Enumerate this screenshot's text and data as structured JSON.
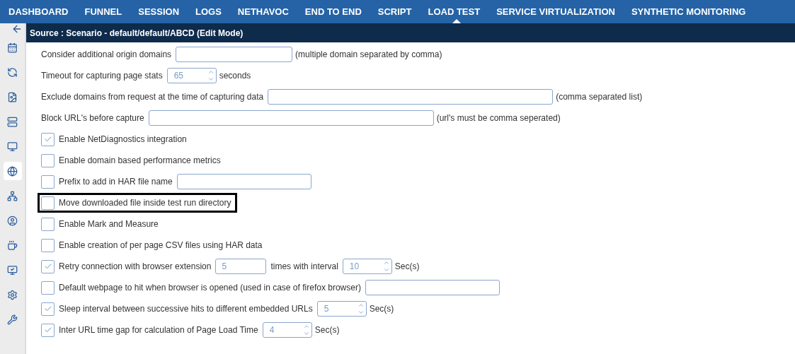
{
  "nav": {
    "tabs": [
      {
        "label": "DASHBOARD",
        "selected": false
      },
      {
        "label": "FUNNEL",
        "selected": false
      },
      {
        "label": "SESSION",
        "selected": false
      },
      {
        "label": "LOGS",
        "selected": false
      },
      {
        "label": "NETHAVOC",
        "selected": false
      },
      {
        "label": "END TO END",
        "selected": false
      },
      {
        "label": "SCRIPT",
        "selected": false
      },
      {
        "label": "LOAD TEST",
        "selected": true
      },
      {
        "label": "SERVICE VIRTUALIZATION",
        "selected": false
      },
      {
        "label": "SYNTHETIC MONITORING",
        "selected": false
      }
    ]
  },
  "sidebar": {
    "items": [
      {
        "selected": false
      },
      {
        "selected": false
      },
      {
        "selected": false
      },
      {
        "selected": false
      },
      {
        "selected": false
      },
      {
        "selected": true
      },
      {
        "selected": false
      },
      {
        "selected": false
      },
      {
        "selected": false
      },
      {
        "selected": false
      },
      {
        "selected": false
      },
      {
        "selected": false
      }
    ]
  },
  "header": {
    "title": "Source : Scenario - default/default/ABCD (Edit Mode)"
  },
  "rows": [
    {
      "highlighted": false,
      "parts": [
        {
          "kind": "label",
          "text": "Consider additional origin domains"
        },
        {
          "kind": "input"
        },
        {
          "kind": "note",
          "text": "(multiple domain separated by comma)"
        }
      ]
    },
    {
      "highlighted": false,
      "parts": [
        {
          "kind": "label",
          "text": "Timeout for capturing page stats"
        },
        {
          "kind": "spinner",
          "value": "65"
        },
        {
          "kind": "note",
          "text": "seconds"
        }
      ]
    },
    {
      "highlighted": false,
      "parts": [
        {
          "kind": "label",
          "text": "Exclude domains from request at the time of capturing data"
        },
        {
          "kind": "wide-input"
        },
        {
          "kind": "note",
          "text": "(comma separated list)"
        }
      ]
    },
    {
      "highlighted": false,
      "parts": [
        {
          "kind": "label",
          "text": "Block URL's before capture"
        },
        {
          "kind": "wide-input"
        },
        {
          "kind": "note",
          "text": "(url's must be comma seperated)"
        }
      ]
    },
    {
      "highlighted": false,
      "checked": true,
      "parts": [
        {
          "kind": "label",
          "text": "Enable NetDiagnostics integration"
        }
      ]
    },
    {
      "highlighted": false,
      "checked": false,
      "parts": [
        {
          "kind": "label",
          "text": "Enable domain based performance metrics"
        }
      ]
    },
    {
      "highlighted": false,
      "checked": false,
      "parts": [
        {
          "kind": "label",
          "text": "Prefix to add in HAR file name"
        },
        {
          "kind": "long-input"
        }
      ]
    },
    {
      "highlighted": true,
      "checked": false,
      "parts": [
        {
          "kind": "label",
          "text": "Move downloaded file inside test run directory"
        }
      ]
    },
    {
      "highlighted": false,
      "checked": false,
      "parts": [
        {
          "kind": "label",
          "text": "Enable Mark and Measure"
        }
      ]
    },
    {
      "highlighted": false,
      "checked": false,
      "parts": [
        {
          "kind": "label",
          "text": "Enable creation of per page CSV files using HAR data"
        }
      ]
    },
    {
      "highlighted": false,
      "checked": true,
      "parts": [
        {
          "kind": "label",
          "text": "Retry connection with browser extension"
        },
        {
          "kind": "short-input",
          "value": "5"
        },
        {
          "kind": "label",
          "text": "times with interval"
        },
        {
          "kind": "spinner",
          "value": "10"
        },
        {
          "kind": "note",
          "text": "Sec(s)"
        }
      ]
    },
    {
      "highlighted": false,
      "checked": false,
      "parts": [
        {
          "kind": "label",
          "text": "Default webpage to hit when browser is opened (used in case of firefox browser)"
        },
        {
          "kind": "long-input"
        }
      ]
    },
    {
      "highlighted": false,
      "checked": true,
      "parts": [
        {
          "kind": "label",
          "text": "Sleep interval between successive hits to different embedded URLs"
        },
        {
          "kind": "spinner",
          "value": "5"
        },
        {
          "kind": "note",
          "text": "Sec(s)"
        }
      ]
    },
    {
      "highlighted": false,
      "checked": true,
      "parts": [
        {
          "kind": "label",
          "text": "Inter URL time gap for calculation of Page Load Time"
        },
        {
          "kind": "spinner",
          "value": "4"
        },
        {
          "kind": "note",
          "text": "Sec(s)"
        }
      ]
    }
  ]
}
